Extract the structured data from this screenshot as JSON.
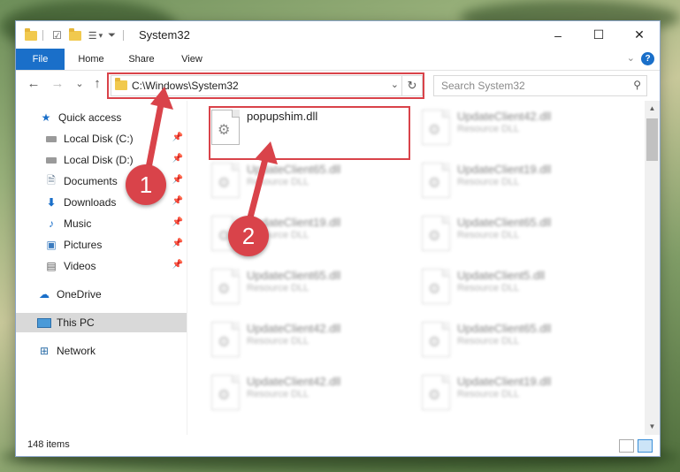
{
  "window": {
    "title": "System32",
    "controls": {
      "minimize": "–",
      "maximize": "☐",
      "close": "✕"
    }
  },
  "ribbon": {
    "tabs": [
      "File",
      "Home",
      "Share",
      "View"
    ]
  },
  "navigation": {
    "back": "←",
    "forward": "→",
    "recent": "⌄",
    "up": "↑",
    "address": "C:\\Windows\\System32",
    "search_placeholder": "Search System32"
  },
  "sidebar": {
    "items": [
      {
        "label": "Quick access",
        "icon": "star-icon",
        "pinned": false
      },
      {
        "label": "Local Disk (C:)",
        "icon": "drive-icon",
        "pinned": true
      },
      {
        "label": "Local Disk (D:)",
        "icon": "drive-icon",
        "pinned": true
      },
      {
        "label": "Documents",
        "icon": "documents-icon",
        "pinned": true
      },
      {
        "label": "Downloads",
        "icon": "download-icon",
        "pinned": true
      },
      {
        "label": "Music",
        "icon": "music-icon",
        "pinned": true
      },
      {
        "label": "Pictures",
        "icon": "pictures-icon",
        "pinned": true
      },
      {
        "label": "Videos",
        "icon": "videos-icon",
        "pinned": true
      },
      {
        "label": "OneDrive",
        "icon": "cloud-icon",
        "pinned": false
      },
      {
        "label": "This PC",
        "icon": "computer-icon",
        "pinned": false,
        "selected": true
      },
      {
        "label": "Network",
        "icon": "network-icon",
        "pinned": false
      }
    ]
  },
  "files": {
    "highlighted": {
      "name": "popupshim.dll",
      "type": ""
    },
    "column_left": [
      {
        "name": "UpdateClient65.dll",
        "type": "Resource DLL"
      },
      {
        "name": "UpdateClient19.dll",
        "type": "Resource DLL"
      },
      {
        "name": "UpdateClient65.dll",
        "type": "Resource DLL"
      },
      {
        "name": "UpdateClient42.dll",
        "type": "Resource DLL"
      },
      {
        "name": "UpdateClient42.dll",
        "type": "Resource DLL"
      }
    ],
    "column_right": [
      {
        "name": "UpdateClient42.dll",
        "type": "Resource DLL"
      },
      {
        "name": "UpdateClient19.dll",
        "type": "Resource DLL"
      },
      {
        "name": "UpdateClient65.dll",
        "type": "Resource DLL"
      },
      {
        "name": "UpdateClient5.dll",
        "type": "Resource DLL"
      },
      {
        "name": "UpdateClient65.dll",
        "type": "Resource DLL"
      },
      {
        "name": "UpdateClient19.dll",
        "type": "Resource DLL"
      }
    ]
  },
  "status": {
    "item_count": "148 items"
  },
  "callouts": {
    "step1": "1",
    "step2": "2"
  },
  "colors": {
    "accent": "#1a6fc9",
    "highlight": "#d9434a",
    "folder": "#f1c94e"
  }
}
